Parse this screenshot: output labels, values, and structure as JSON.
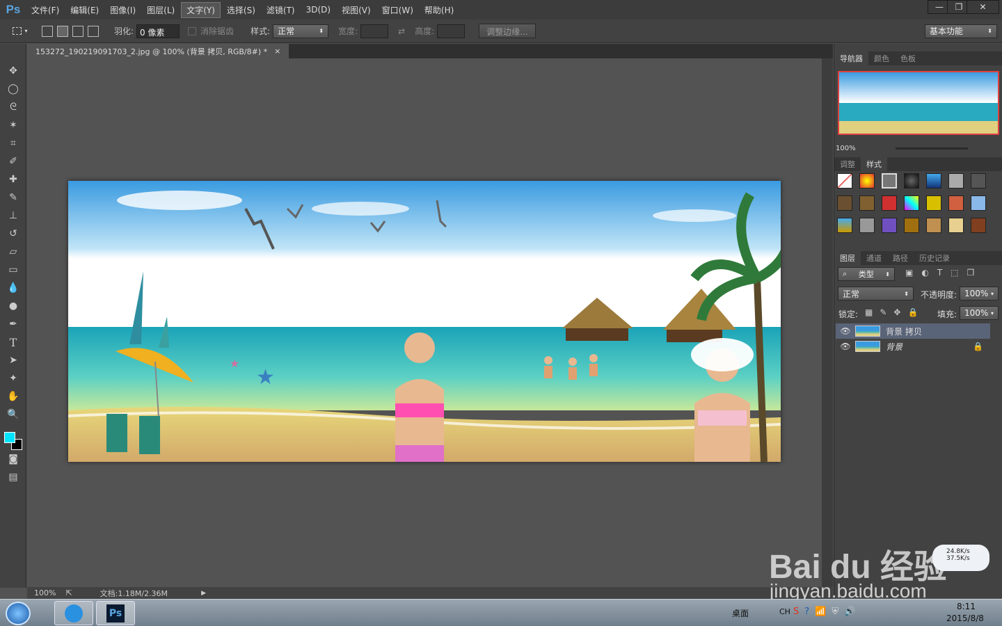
{
  "app": {
    "logo": "Ps"
  },
  "menu": [
    "文件(F)",
    "编辑(E)",
    "图像(I)",
    "图层(L)",
    "文字(Y)",
    "选择(S)",
    "滤镜(T)",
    "3D(D)",
    "视图(V)",
    "窗口(W)",
    "帮助(H)"
  ],
  "window_controls": {
    "minimize": "—",
    "restore": "❐",
    "close": "✕"
  },
  "options": {
    "feather_label": "羽化:",
    "feather_value": "0 像素",
    "antialias_label": "消除锯齿",
    "style_label": "样式:",
    "style_value": "正常",
    "width_label": "宽度:",
    "height_label": "高度:",
    "refine_label": "调整边缘...",
    "workspace": "基本功能"
  },
  "document": {
    "tab_title": "153272_190219091703_2.jpg @ 100% (背景 拷贝, RGB/8#) *",
    "close": "×"
  },
  "status": {
    "zoom": "100%",
    "doc_size": "文档:1.18M/2.36M"
  },
  "panels": {
    "navigator_tabs": [
      "导航器",
      "颜色",
      "色板"
    ],
    "navigator_zoom": "100%",
    "style_tabs": [
      "调整",
      "样式"
    ],
    "layer_tabs": [
      "图层",
      "通道",
      "路径",
      "历史记录"
    ],
    "filter_kind": "类型",
    "blend_mode": "正常",
    "opacity_label": "不透明度:",
    "opacity": "100%",
    "lock_label": "锁定:",
    "fill_label": "填充:",
    "fill": "100%",
    "layers": [
      {
        "name": "背景 拷贝",
        "selected": true
      },
      {
        "name": "背景",
        "locked": true
      }
    ]
  },
  "taskbar": {
    "desktop": "桌面",
    "lang": "CH",
    "net_up": "24.8K/s",
    "net_down": "37.5K/s",
    "time": "8:11",
    "date": "2015/8/8"
  },
  "watermark": {
    "brand": "Bai du 经验",
    "url": "jingyan.baidu.com"
  },
  "colors": {
    "foreground": "#00e5ff",
    "background": "#000000",
    "accent": "#5aa5e0"
  }
}
